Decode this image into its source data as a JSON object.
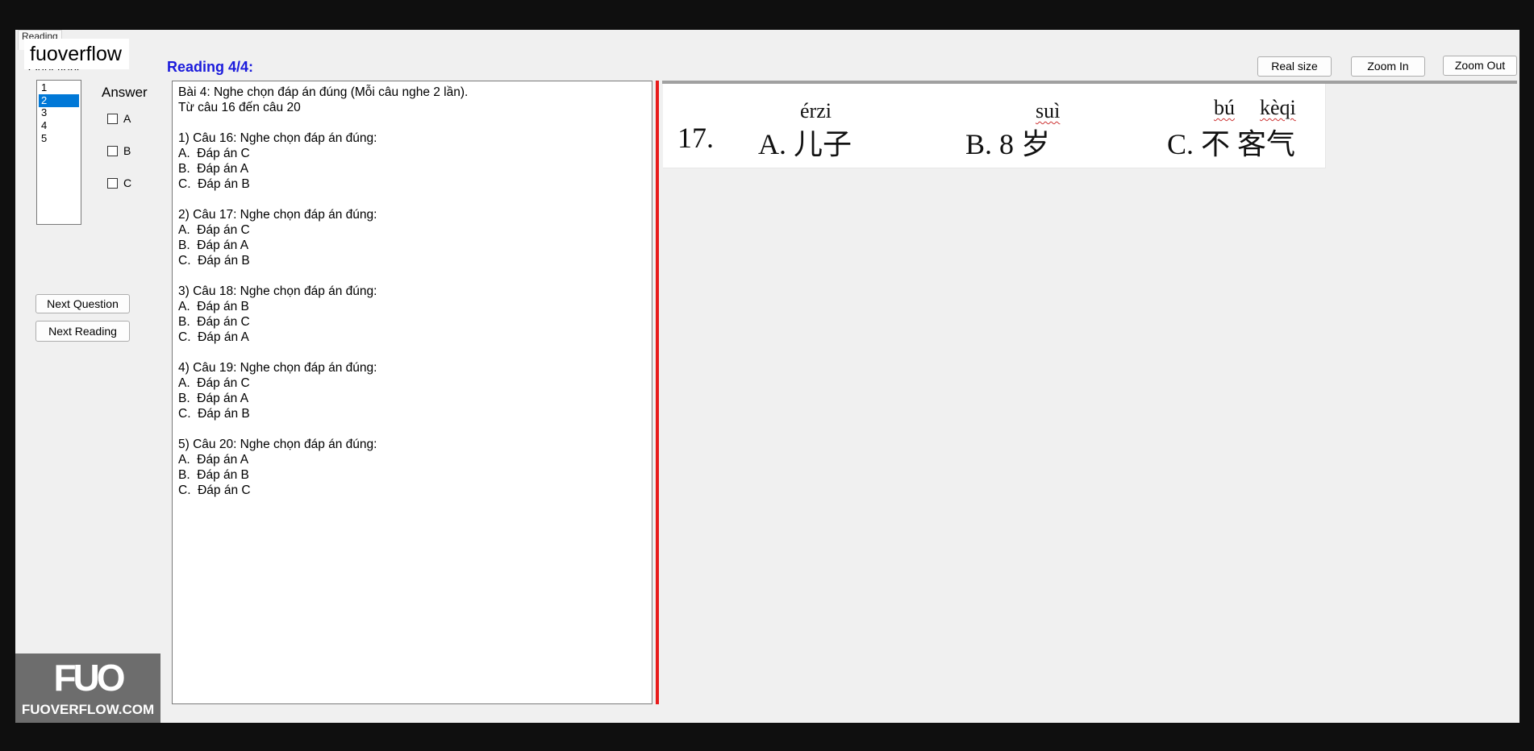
{
  "tab": {
    "label": "Reading"
  },
  "watermark_top": "fuoverflow",
  "questions_group": {
    "label": "Questions",
    "items": [
      "1",
      "2",
      "3",
      "4",
      "5"
    ],
    "selected_index": 1
  },
  "answer": {
    "label": "Answer",
    "options": [
      "A",
      "B",
      "C"
    ]
  },
  "buttons": {
    "next_question": "Next Question",
    "next_reading": "Next Reading",
    "real_size": "Real size",
    "zoom_in": "Zoom In",
    "zoom_out": "Zoom Out"
  },
  "reading_title": "Reading 4/4:",
  "text_lines": [
    "Bài 4: Nghe chọn đáp án đúng (Mỗi câu nghe 2 lần).",
    "Từ câu 16 đến câu 20",
    "",
    "1) Câu 16: Nghe chọn đáp án đúng:",
    "A.  Đáp án C",
    "B.  Đáp án A",
    "C.  Đáp án B",
    "",
    "2) Câu 17: Nghe chọn đáp án đúng:",
    "A.  Đáp án C",
    "B.  Đáp án A",
    "C.  Đáp án B",
    "",
    "3) Câu 18: Nghe chọn đáp án đúng:",
    "A.  Đáp án B",
    "B.  Đáp án C",
    "C.  Đáp án A",
    "",
    "4) Câu 19: Nghe chọn đáp án đúng:",
    "A.  Đáp án C",
    "B.  Đáp án A",
    "C.  Đáp án B",
    "",
    "5) Câu 20: Nghe chọn đáp án đúng:",
    "A.  Đáp án A",
    "B.  Đáp án B",
    "C.  Đáp án C"
  ],
  "image_question": {
    "number": "17.",
    "options": [
      {
        "label": "A. 儿子",
        "pinyin": [
          "érzi"
        ]
      },
      {
        "label": "B. 8 岁",
        "pinyin": [
          "suì"
        ]
      },
      {
        "label": "C. 不 客气",
        "pinyin": [
          "bú",
          "kèqi"
        ]
      }
    ]
  },
  "logo": {
    "mark": "FUO",
    "text": "FUOVERFLOW.COM"
  },
  "colors": {
    "accent_selection": "#0078d7",
    "reading_title": "#1a1adc",
    "splitter": "#e81b1b",
    "logo_bg": "#6d6d6d"
  }
}
